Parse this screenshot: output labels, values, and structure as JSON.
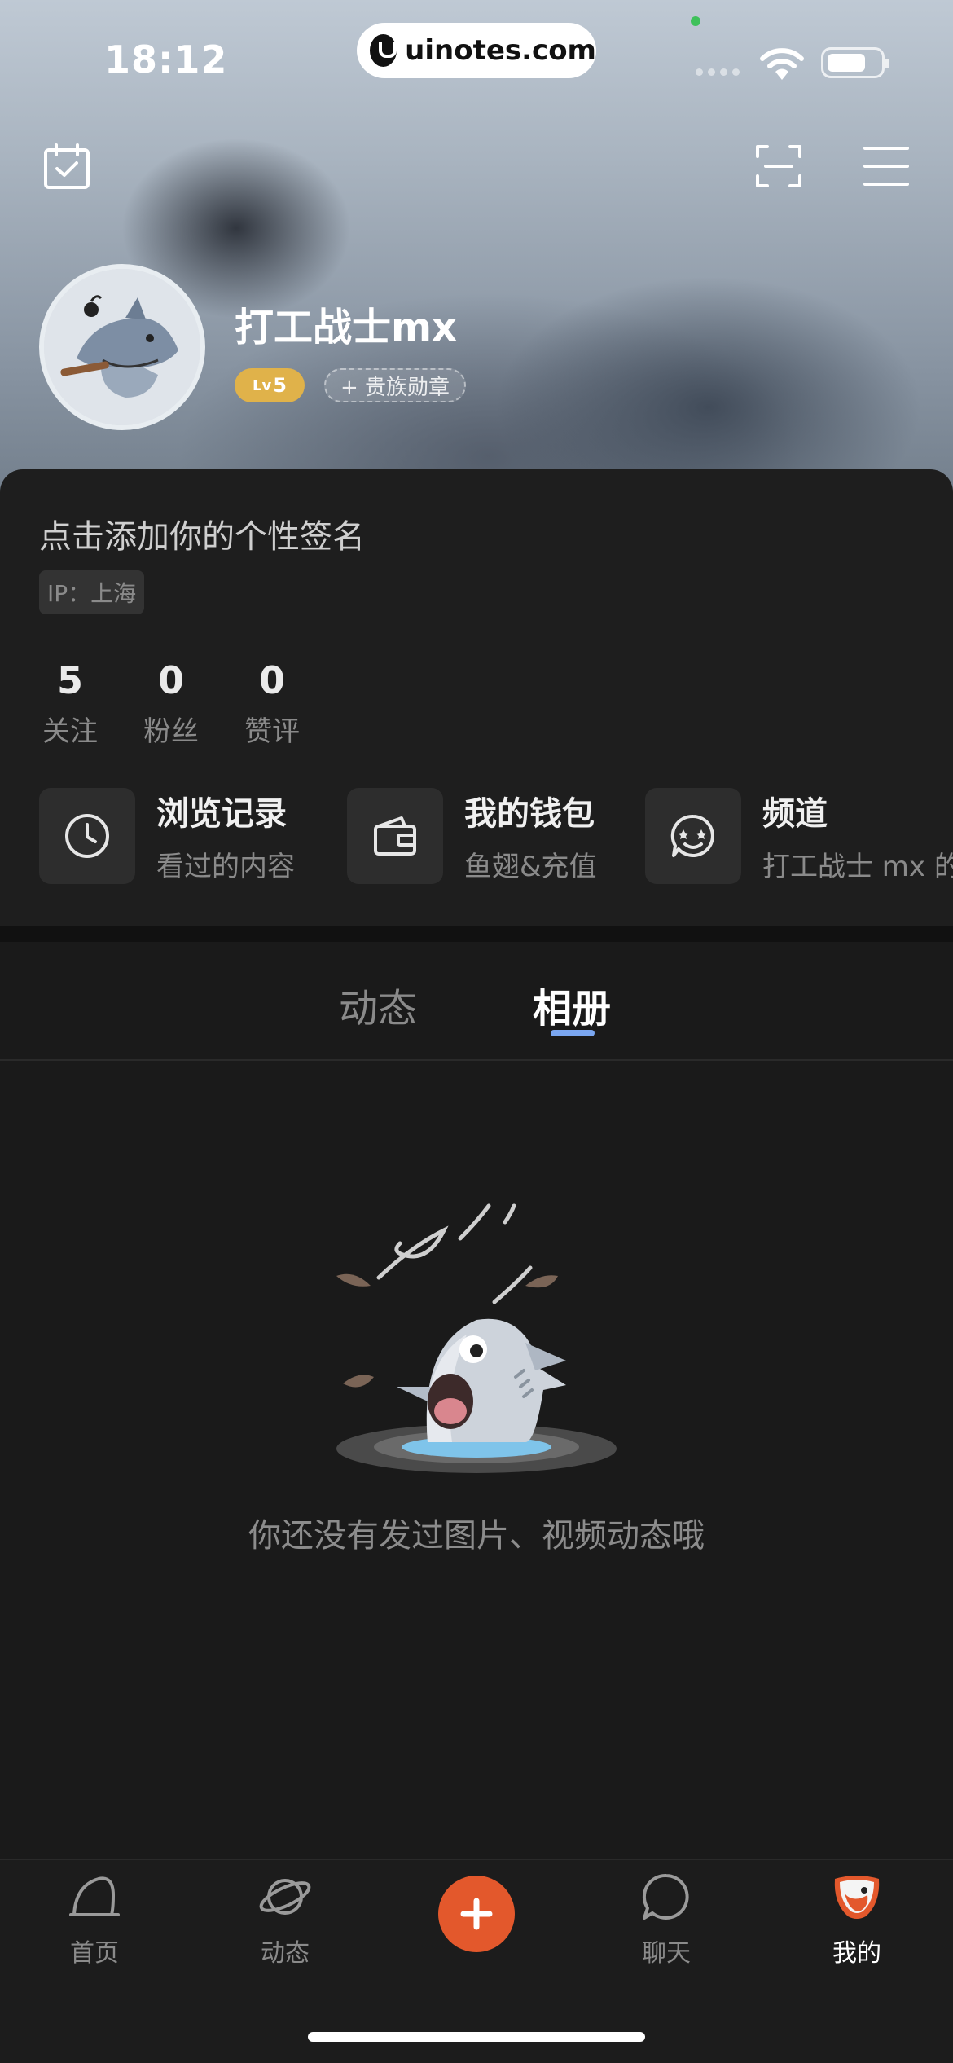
{
  "status_bar": {
    "time": "18:12"
  },
  "watermark": {
    "text": "uinotes.com"
  },
  "profile": {
    "nickname": "打工战士mx",
    "level_prefix": "Lv",
    "level_num": "5",
    "noble_badge": "+ 贵族勋章",
    "signature": "点击添加你的个性签名",
    "ip_label": "IP：上海"
  },
  "stats": [
    {
      "value": "5",
      "label": "关注"
    },
    {
      "value": "0",
      "label": "粉丝"
    },
    {
      "value": "0",
      "label": "赞评"
    }
  ],
  "quick_links": [
    {
      "title": "浏览记录",
      "subtitle": "看过的内容",
      "icon": "clock-icon"
    },
    {
      "title": "我的钱包",
      "subtitle": "鱼翅&充值",
      "icon": "wallet-icon"
    },
    {
      "title": "频道",
      "subtitle": "打工战士 mx 的",
      "icon": "channel-icon"
    }
  ],
  "tabs": [
    {
      "label": "动态",
      "active": false
    },
    {
      "label": "相册",
      "active": true
    }
  ],
  "empty_state": {
    "text": "你还没有发过图片、视频动态哦"
  },
  "bottom_nav": [
    {
      "label": "首页",
      "icon": "home-icon",
      "active": false
    },
    {
      "label": "动态",
      "icon": "planet-icon",
      "active": false
    },
    {
      "label": "聊天",
      "icon": "chat-bubble-icon",
      "active": false
    },
    {
      "label": "我的",
      "icon": "profile-shark-icon",
      "active": true
    }
  ],
  "colors": {
    "accent": "#e3582c",
    "level": "#e0b24a",
    "tab_indicator": "#7aa6f0"
  }
}
